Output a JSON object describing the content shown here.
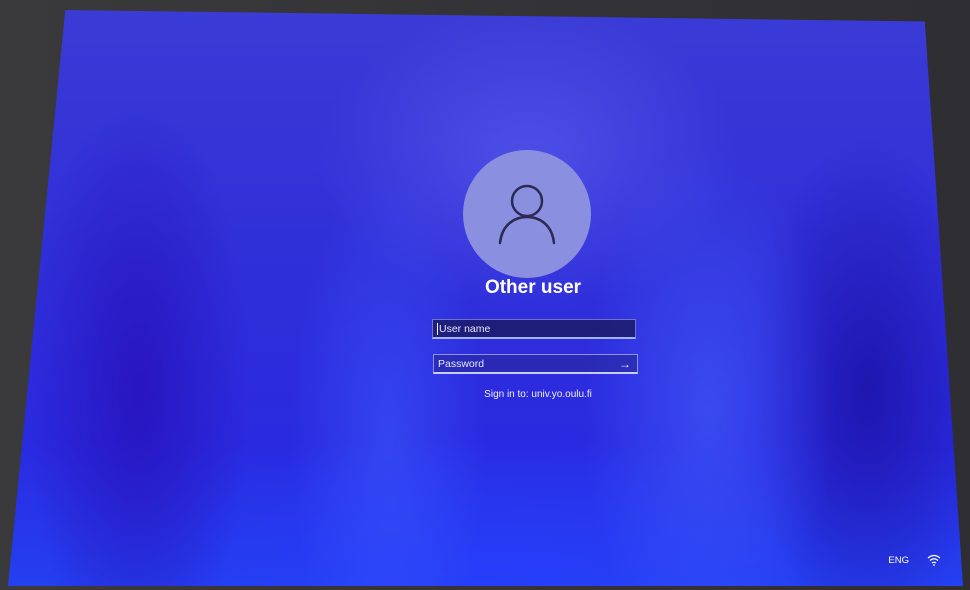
{
  "login": {
    "account_name": "Other user",
    "username_field": {
      "placeholder": "User name",
      "value": ""
    },
    "password_field": {
      "placeholder": "Password",
      "value": ""
    },
    "sign_in_to": "Sign in to: univ.yo.oulu.fi",
    "submit_icon": "arrow-right-icon",
    "avatar_icon": "person-icon"
  },
  "tray": {
    "language": "ENG",
    "network_icon": "wifi-icon"
  },
  "colors": {
    "background": "#3030d8",
    "avatar": "#8b8fe0",
    "text": "#ffffff"
  }
}
